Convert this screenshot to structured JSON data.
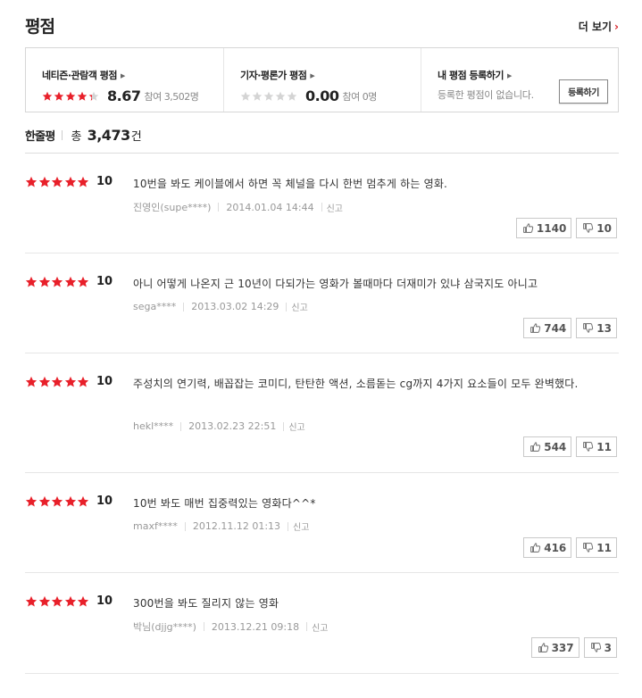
{
  "header": {
    "title": "평점",
    "more_label": "더 보기",
    "more_icon": "chevron-right-icon"
  },
  "summary": {
    "netizen": {
      "label": "네티즌·관람객 평점",
      "stars": 4.3,
      "score": "8.67",
      "participants": "참여 3,502명"
    },
    "critic": {
      "label": "기자·평론가 평점",
      "stars": 0,
      "score": "0.00",
      "participants": "참여 0명"
    },
    "mine": {
      "label": "내 평점 등록하기",
      "message": "등록한 평점이 없습니다.",
      "button": "등록하기"
    }
  },
  "oneline": {
    "label": "한줄평",
    "total_prefix": "총",
    "total": "3,473",
    "unit": "건"
  },
  "colors": {
    "star_on": "#e8202a",
    "star_off": "#d4d4d4",
    "accent": "#d8232a"
  },
  "reviews": [
    {
      "score": "10",
      "text": "10번을 봐도 케이블에서 하면 꼭 체널을 다시 한번 멈추게 하는 영화.",
      "user": "진영인(supe****)",
      "date": "2014.01.04 14:44",
      "report": "신고",
      "likes": "1140",
      "dislikes": "10"
    },
    {
      "score": "10",
      "text": "아니 어떻게 나온지 근 10년이 다되가는 영화가 볼때마다 더재미가 있냐 삼국지도 아니고",
      "user": "sega****",
      "date": "2013.03.02 14:29",
      "report": "신고",
      "likes": "744",
      "dislikes": "13"
    },
    {
      "score": "10",
      "text": "주성치의 연기력, 배꼽잡는 코미디, 탄탄한 액션, 소름돋는 cg까지 4가지 요소들이 모두 완벽했다.",
      "user": "hekl****",
      "date": "2013.02.23 22:51",
      "report": "신고",
      "likes": "544",
      "dislikes": "11"
    },
    {
      "score": "10",
      "text": "10번 봐도 매번 집중력있는 영화다^^*",
      "user": "maxf****",
      "date": "2012.11.12 01:13",
      "report": "신고",
      "likes": "416",
      "dislikes": "11"
    },
    {
      "score": "10",
      "text": "300번을 봐도 질리지 않는 영화",
      "user": "박님(djjg****)",
      "date": "2013.12.21 09:18",
      "report": "신고",
      "likes": "337",
      "dislikes": "3"
    }
  ]
}
